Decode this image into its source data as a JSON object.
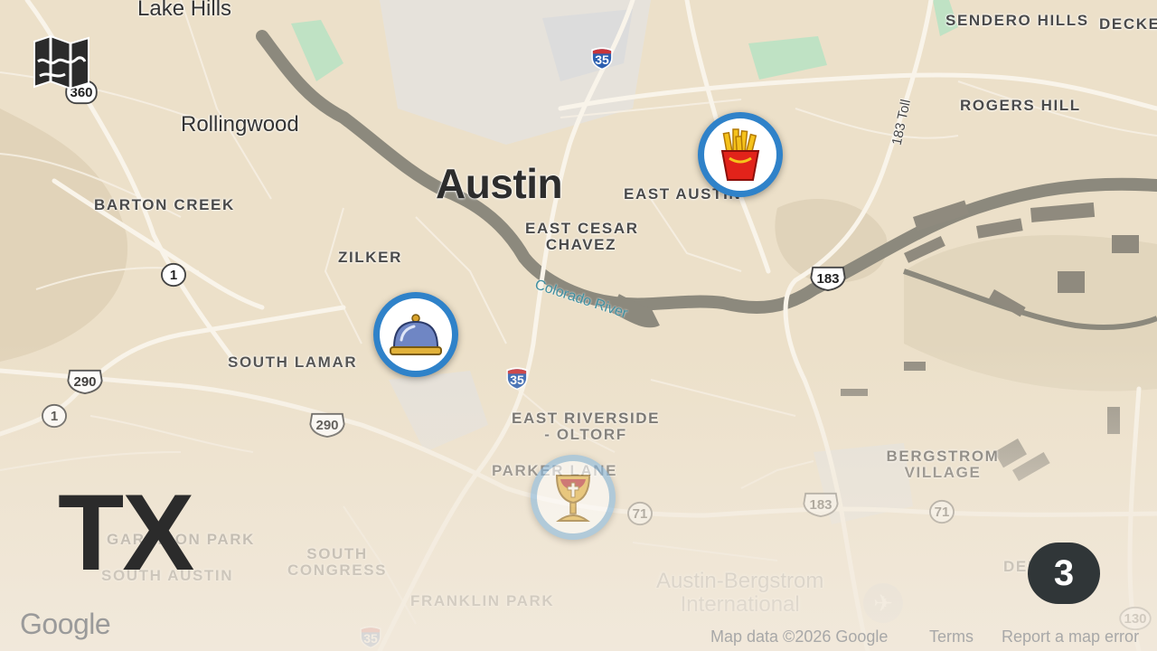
{
  "map": {
    "state_label": "TX",
    "count_badge": "3",
    "city_label": "Austin",
    "neighborhoods": {
      "lake_hills": "Lake Hills",
      "rollingwood": "Rollingwood",
      "barton_creek": "BARTON CREEK",
      "zilker": "ZILKER",
      "south_lamar": "SOUTH LAMAR",
      "east_austin": "EAST AUSTIN",
      "east_cesar_chavez_1": "EAST CESAR",
      "east_cesar_chavez_2": "CHAVEZ",
      "east_riverside_1": "EAST RIVERSIDE",
      "east_riverside_2": "- OLTORF",
      "parker_lane": "PARKER LANE",
      "sendero_hills": "SENDERO HILLS",
      "decker": "DECKER",
      "rogers_hill": "ROGERS HILL",
      "bergstrom_1": "BERGSTROM",
      "bergstrom_2": "VILLAGE",
      "garrison_park": "GARRISON PARK",
      "south_austin": "SOUTH AUSTIN",
      "south_congress_1": "SOUTH",
      "south_congress_2": "CONGRESS",
      "franklin_park": "FRANKLIN PARK",
      "del_valle": "DEL"
    },
    "water_label": "Colorado River",
    "toll_label": "183 Toll",
    "airport_1": "Austin-Bergstrom",
    "airport_2": "International",
    "shields": {
      "i35_north": "35",
      "i35_center": "35",
      "i35_south": "35",
      "us290_west": "290",
      "us290_center": "290",
      "us183_north": "183",
      "us183_south": "183",
      "tx71_west": "71",
      "tx71_east": "71",
      "tx1_north": "1",
      "tx1_south": "1",
      "rm360": "360",
      "fm130": "130"
    },
    "markers": [
      {
        "name": "french-fries",
        "icon": "french-fries-icon"
      },
      {
        "name": "room-service",
        "icon": "service-bell-icon"
      },
      {
        "name": "chalice",
        "icon": "chalice-icon"
      }
    ],
    "google_logo": "Google",
    "attribution": {
      "map_data": "Map data ©2026 Google",
      "terms": "Terms",
      "report": "Report a map error"
    },
    "colors": {
      "land": "#ece0c9",
      "park": "#bfe2c4",
      "water": "#8a877b",
      "marker_ring": "#2f82c9",
      "badge": "#303638"
    }
  }
}
